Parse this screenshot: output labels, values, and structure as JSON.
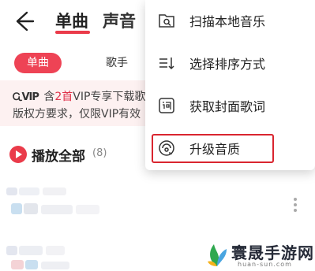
{
  "topbar": {
    "tabs": [
      {
        "label": "单曲",
        "active": true
      },
      {
        "label": "声音",
        "active": false
      }
    ]
  },
  "chips": {
    "active": "单曲",
    "other": "歌手"
  },
  "notice": {
    "line1_prefix": "含",
    "line1_count": "2首",
    "line1_suffix": "VIP专享下载歌",
    "line2": "版权方要求，仅限VIP有效"
  },
  "play_all": {
    "label": "播放全部",
    "count": "(8)"
  },
  "menu": {
    "items": [
      {
        "label": "扫描本地音乐",
        "icon": "scan-local-icon"
      },
      {
        "label": "选择排序方式",
        "icon": "sort-icon"
      },
      {
        "label": "获取封面歌词",
        "icon": "lyrics-icon"
      },
      {
        "label": "升级音质",
        "icon": "audio-quality-icon",
        "highlighted": true
      }
    ]
  },
  "watermark": {
    "text": "寰晟手游网",
    "url": "huan-sun.com"
  },
  "colors": {
    "accent": "#ea3b4a",
    "highlight_border": "#d9252f",
    "notice_bg": "#fdf1f1"
  }
}
